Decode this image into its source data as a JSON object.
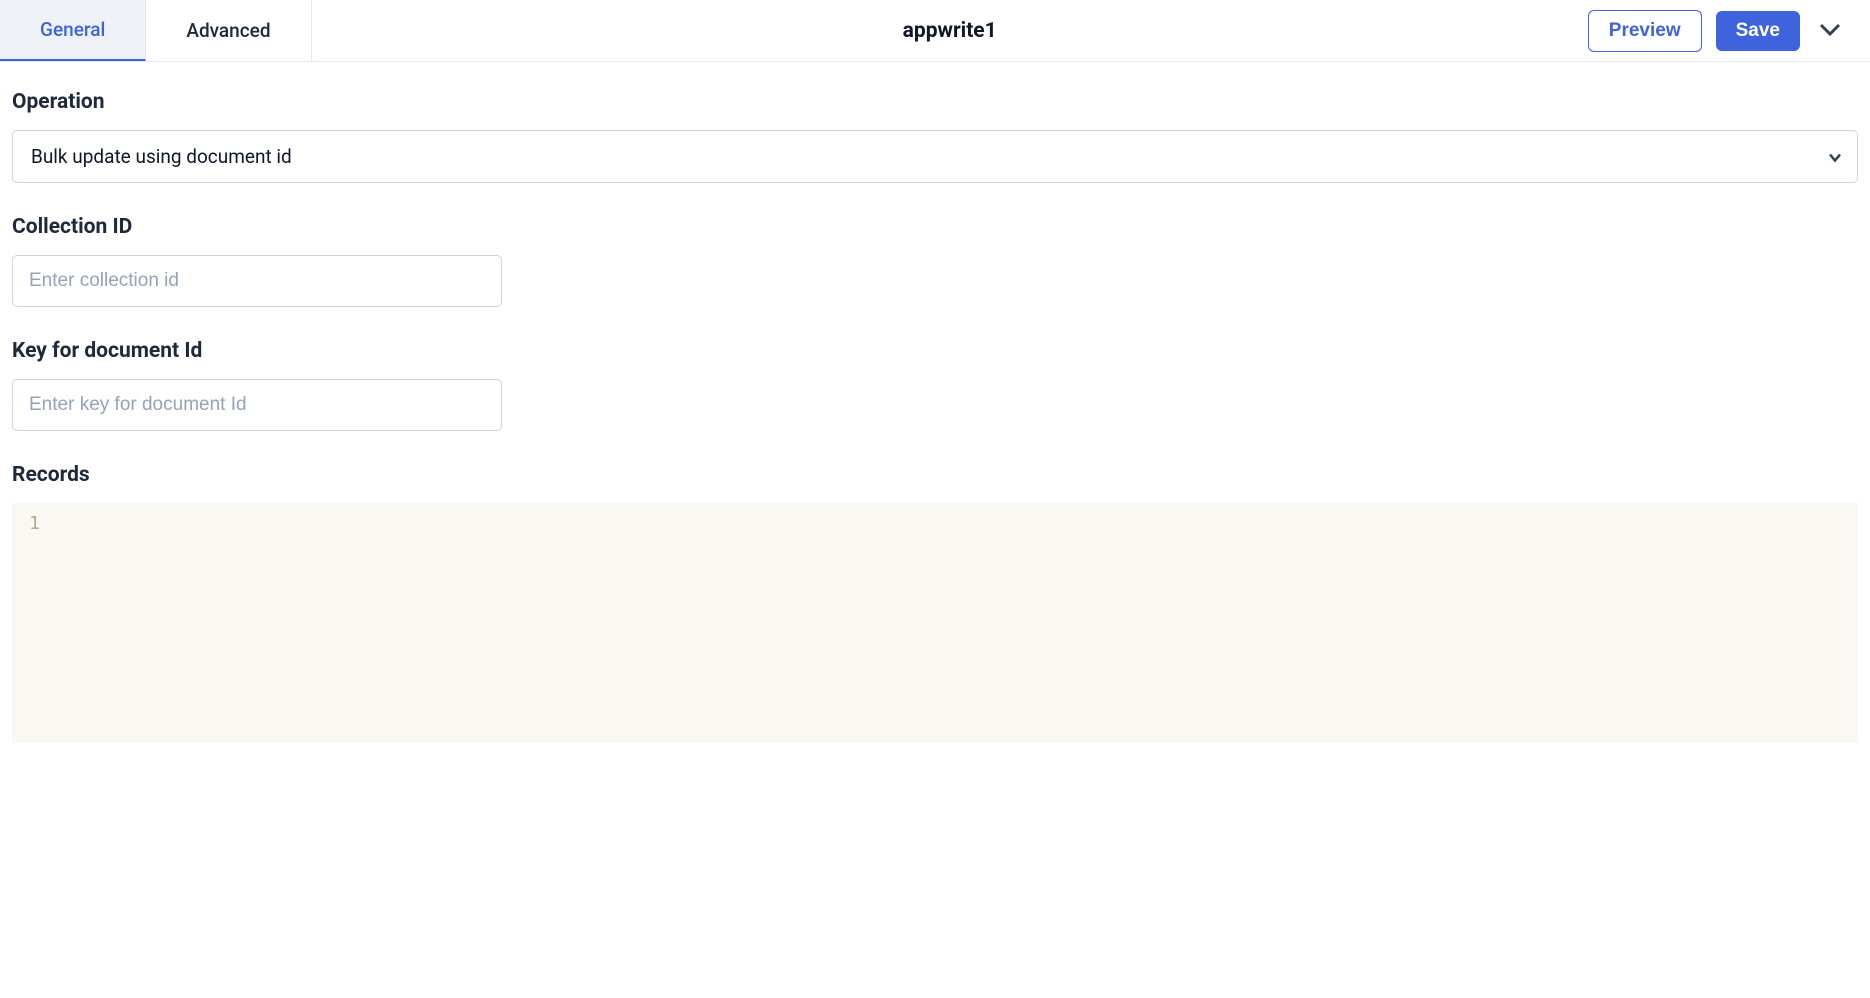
{
  "header": {
    "tabs": [
      {
        "label": "General",
        "active": true
      },
      {
        "label": "Advanced",
        "active": false
      }
    ],
    "title": "appwrite1",
    "preview_label": "Preview",
    "save_label": "Save"
  },
  "form": {
    "operation": {
      "label": "Operation",
      "value": "Bulk update using document id"
    },
    "collection_id": {
      "label": "Collection ID",
      "placeholder": "Enter collection id",
      "value": ""
    },
    "key_for_document_id": {
      "label": "Key for document Id",
      "placeholder": "Enter key for document Id",
      "value": ""
    },
    "records": {
      "label": "Records",
      "line_number": "1",
      "content": ""
    }
  }
}
